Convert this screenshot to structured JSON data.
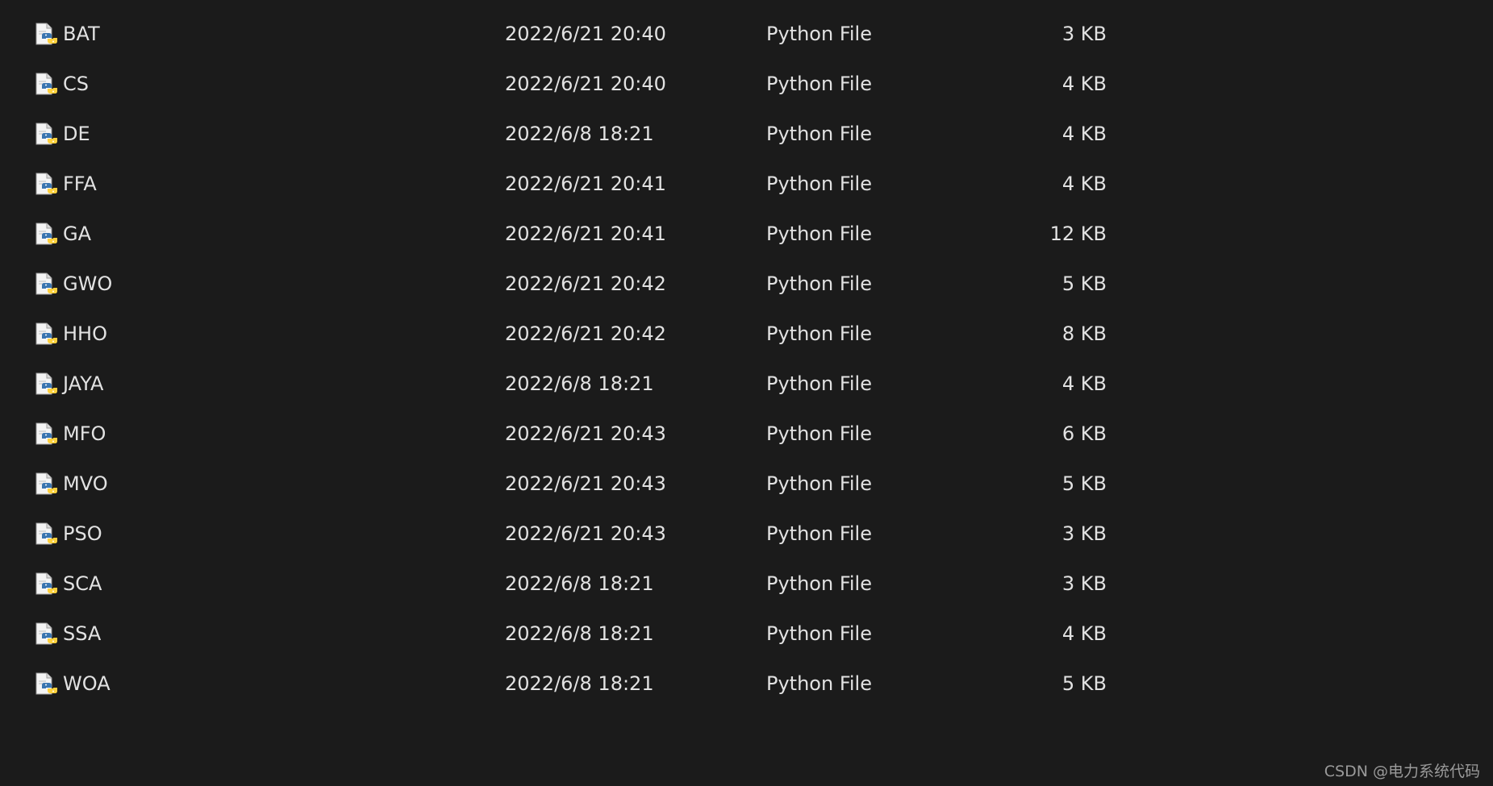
{
  "colors": {
    "background": "#1b1b1b",
    "text": "#e2e2e2",
    "python_blue": "#3a75b0",
    "python_yellow": "#ffd13d"
  },
  "file_icon": "python-file-icon",
  "files": [
    {
      "name": "BAT",
      "modified": "2022/6/21 20:40",
      "type": "Python File",
      "size": "3 KB"
    },
    {
      "name": "CS",
      "modified": "2022/6/21 20:40",
      "type": "Python File",
      "size": "4 KB"
    },
    {
      "name": "DE",
      "modified": "2022/6/8 18:21",
      "type": "Python File",
      "size": "4 KB"
    },
    {
      "name": "FFA",
      "modified": "2022/6/21 20:41",
      "type": "Python File",
      "size": "4 KB"
    },
    {
      "name": "GA",
      "modified": "2022/6/21 20:41",
      "type": "Python File",
      "size": "12 KB"
    },
    {
      "name": "GWO",
      "modified": "2022/6/21 20:42",
      "type": "Python File",
      "size": "5 KB"
    },
    {
      "name": "HHO",
      "modified": "2022/6/21 20:42",
      "type": "Python File",
      "size": "8 KB"
    },
    {
      "name": "JAYA",
      "modified": "2022/6/8 18:21",
      "type": "Python File",
      "size": "4 KB"
    },
    {
      "name": "MFO",
      "modified": "2022/6/21 20:43",
      "type": "Python File",
      "size": "6 KB"
    },
    {
      "name": "MVO",
      "modified": "2022/6/21 20:43",
      "type": "Python File",
      "size": "5 KB"
    },
    {
      "name": "PSO",
      "modified": "2022/6/21 20:43",
      "type": "Python File",
      "size": "3 KB"
    },
    {
      "name": "SCA",
      "modified": "2022/6/8 18:21",
      "type": "Python File",
      "size": "3 KB"
    },
    {
      "name": "SSA",
      "modified": "2022/6/8 18:21",
      "type": "Python File",
      "size": "4 KB"
    },
    {
      "name": "WOA",
      "modified": "2022/6/8 18:21",
      "type": "Python File",
      "size": "5 KB"
    }
  ],
  "watermark": "CSDN @电力系统代码"
}
